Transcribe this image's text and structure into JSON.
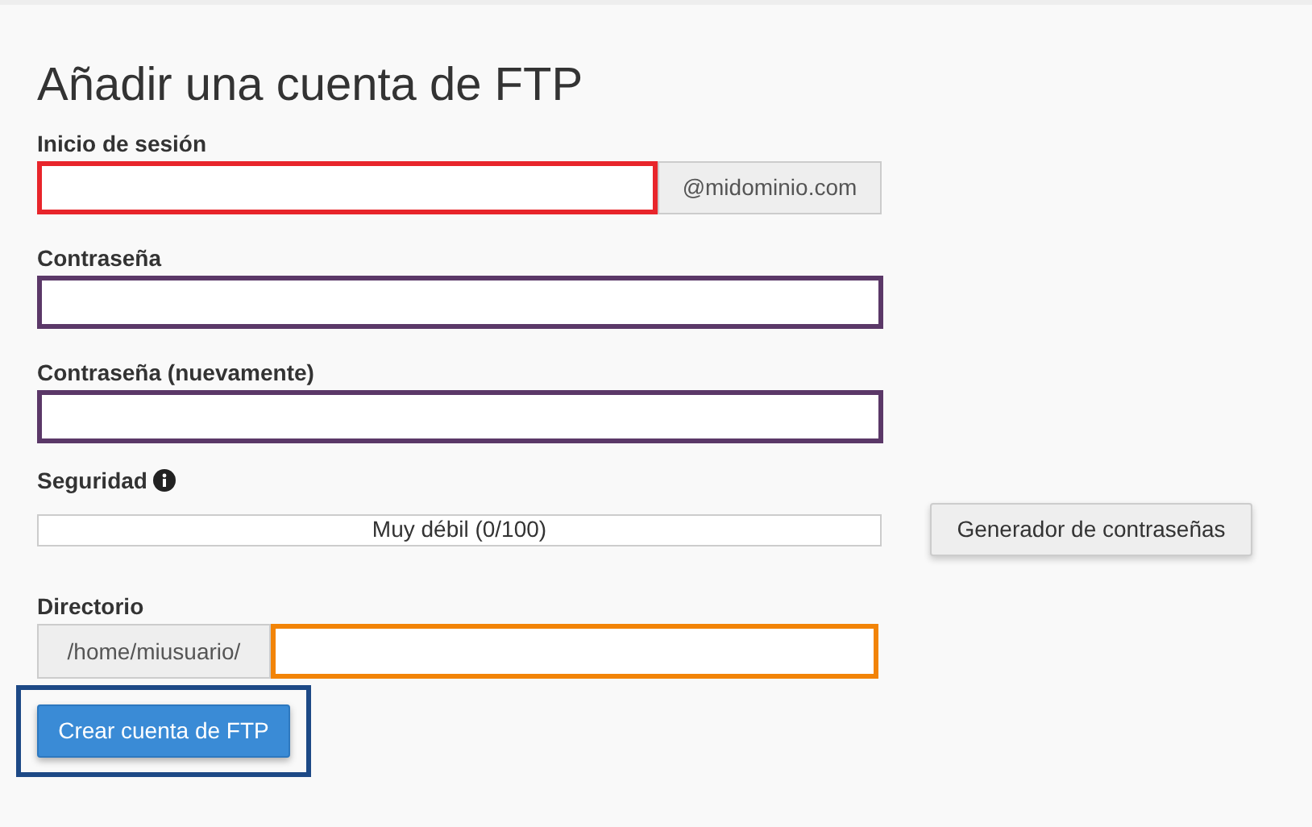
{
  "title": "Añadir una cuenta de FTP",
  "fields": [
    {
      "label": "Inicio de sesión",
      "color": "#e8252b",
      "suffix": "@midominio.com"
    },
    {
      "label": "Contraseña",
      "color": "#5b3868"
    },
    {
      "label": "Contraseña (nuevamente)",
      "color": "#5b3868"
    }
  ],
  "security": {
    "label": "Seguridad",
    "level": 0,
    "reading": "Muy débil (0/100)"
  },
  "generator_button": "Generador de contraseñas",
  "directory": {
    "label": "Directorio",
    "prefix": "/home/miusuario/",
    "color": "#f28407"
  },
  "submit": {
    "label": "Crear cuenta de FTP",
    "color": "#1d4986"
  }
}
